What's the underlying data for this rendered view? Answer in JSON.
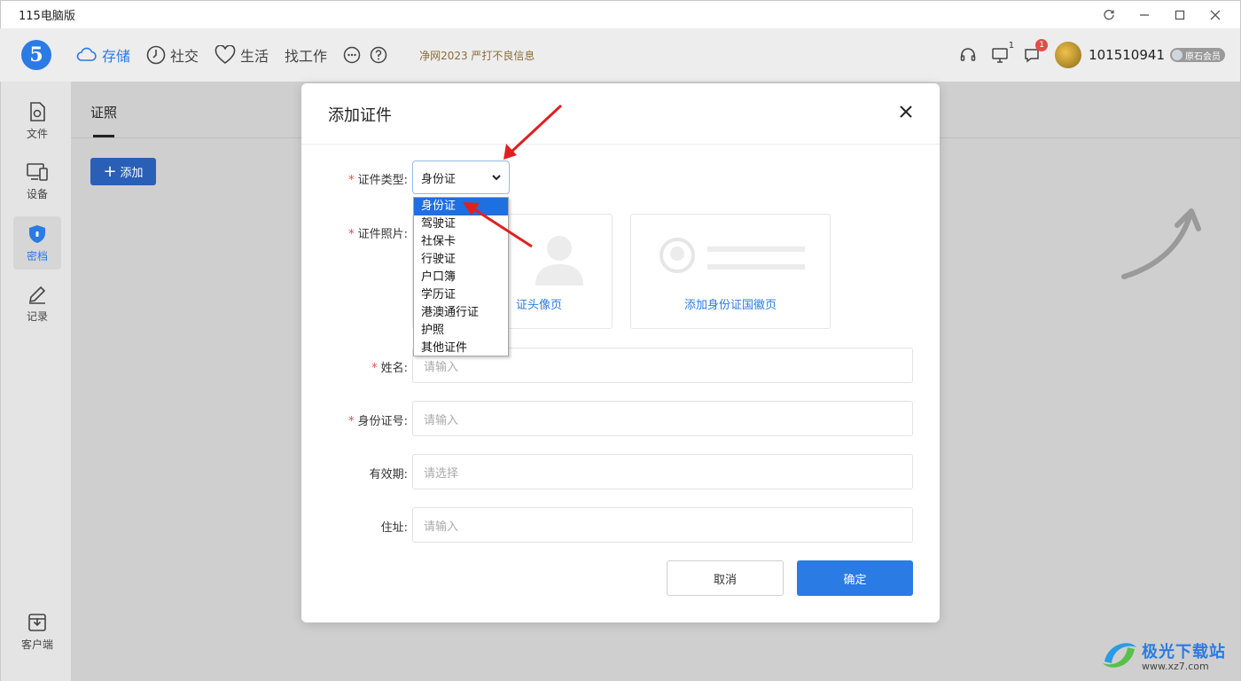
{
  "window": {
    "title": "115电脑版"
  },
  "header": {
    "logo": "5",
    "nav": [
      {
        "label": "存储",
        "icon": "cloud-icon",
        "active": true
      },
      {
        "label": "社交",
        "icon": "clock-icon"
      },
      {
        "label": "生活",
        "icon": "heart-icon"
      },
      {
        "label": "找工作"
      }
    ],
    "slogan": "净网2023 严打不良信息",
    "devices_count": "1",
    "messages_badge": "1",
    "username": "101510941",
    "member_label": "原石会员"
  },
  "sidebar": {
    "items": [
      {
        "label": "文件",
        "icon": "file-icon"
      },
      {
        "label": "设备",
        "icon": "device-icon"
      },
      {
        "label": "密档",
        "icon": "shield-lock-icon",
        "active": true
      },
      {
        "label": "记录",
        "icon": "pencil-icon"
      }
    ],
    "bottom_item": {
      "label": "客户端",
      "icon": "download-box-icon"
    }
  },
  "main": {
    "tab": "证照",
    "add_button": "添加"
  },
  "modal": {
    "title": "添加证件",
    "type_label": "证件类型:",
    "type_selected": "身份证",
    "type_options": [
      "身份证",
      "驾驶证",
      "社保卡",
      "行驶证",
      "户口簿",
      "学历证",
      "港澳通行证",
      "护照",
      "其他证件"
    ],
    "photo_label": "证件照片:",
    "photo_front_caption": "证头像页",
    "photo_back_caption": "添加身份证国徽页",
    "name_label": "姓名:",
    "name_placeholder": "请输入",
    "id_label": "身份证号:",
    "id_placeholder": "请输入",
    "validity_label": "有效期:",
    "validity_placeholder": "请选择",
    "address_label": "住址:",
    "address_placeholder": "请输入",
    "cancel": "取消",
    "confirm": "确定"
  },
  "watermark": {
    "title": "极光下载站",
    "url": "www.xz7.com"
  },
  "colors": {
    "accent": "#2a7be4",
    "annotation_arrow": "#e02020",
    "badge": "#e84a4a"
  }
}
